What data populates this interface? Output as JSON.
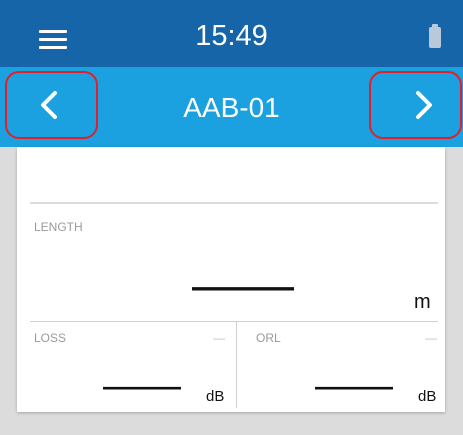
{
  "header": {
    "time": "15:49",
    "menu_icon": "hamburger-menu-icon",
    "battery_icon": "battery-icon",
    "bar_color": "#1565a8"
  },
  "nav": {
    "title": "AAB-01",
    "prev_icon": "chevron-left-icon",
    "next_icon": "chevron-right-icon",
    "bar_color": "#1ba0e0",
    "highlight_color": "#e2202a"
  },
  "measurements": {
    "length": {
      "label": "LENGTH",
      "value": "———",
      "unit": "m"
    },
    "loss": {
      "label": "LOSS",
      "indicator": "—",
      "value": "———",
      "unit": "dB"
    },
    "orl": {
      "label": "ORL",
      "indicator": "—",
      "value": "———",
      "unit": "dB"
    }
  }
}
